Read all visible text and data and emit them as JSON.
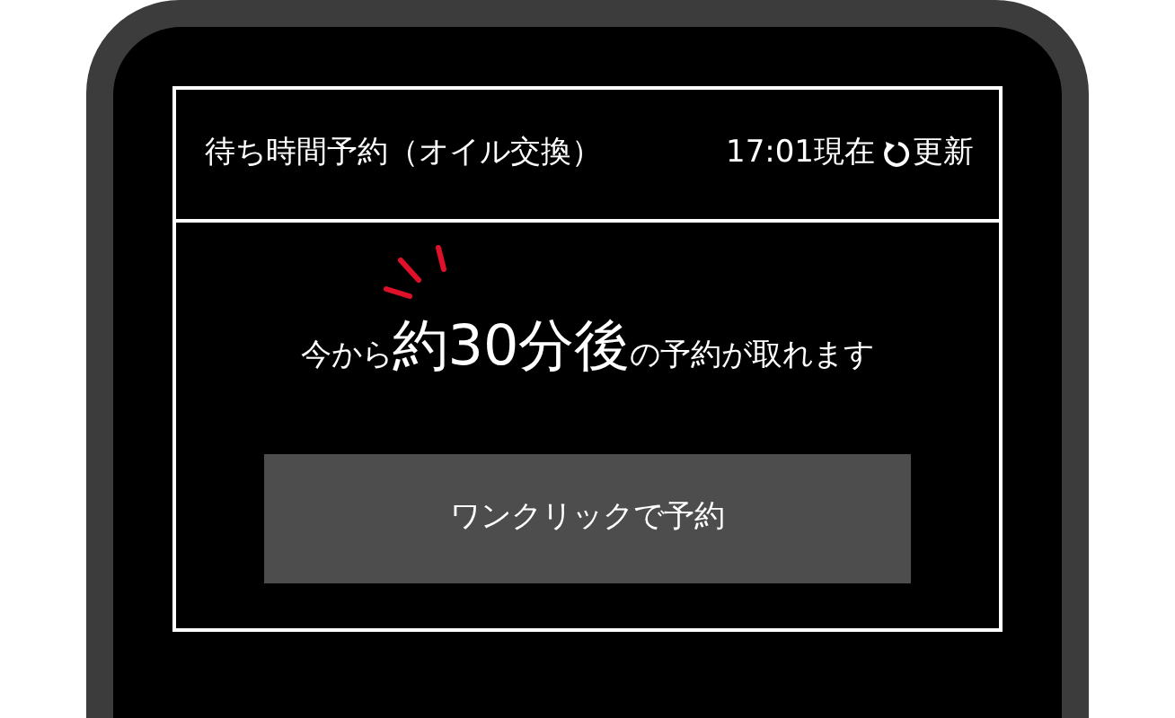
{
  "header": {
    "title": "待ち時間予約（オイル交換）",
    "time": "17:01現在",
    "refresh": "更新"
  },
  "message": "今から**約30分後**の予約が取れます",
  "buttons": [
    {
      "label": "ワンクリックで予約"
    }
  ]
}
